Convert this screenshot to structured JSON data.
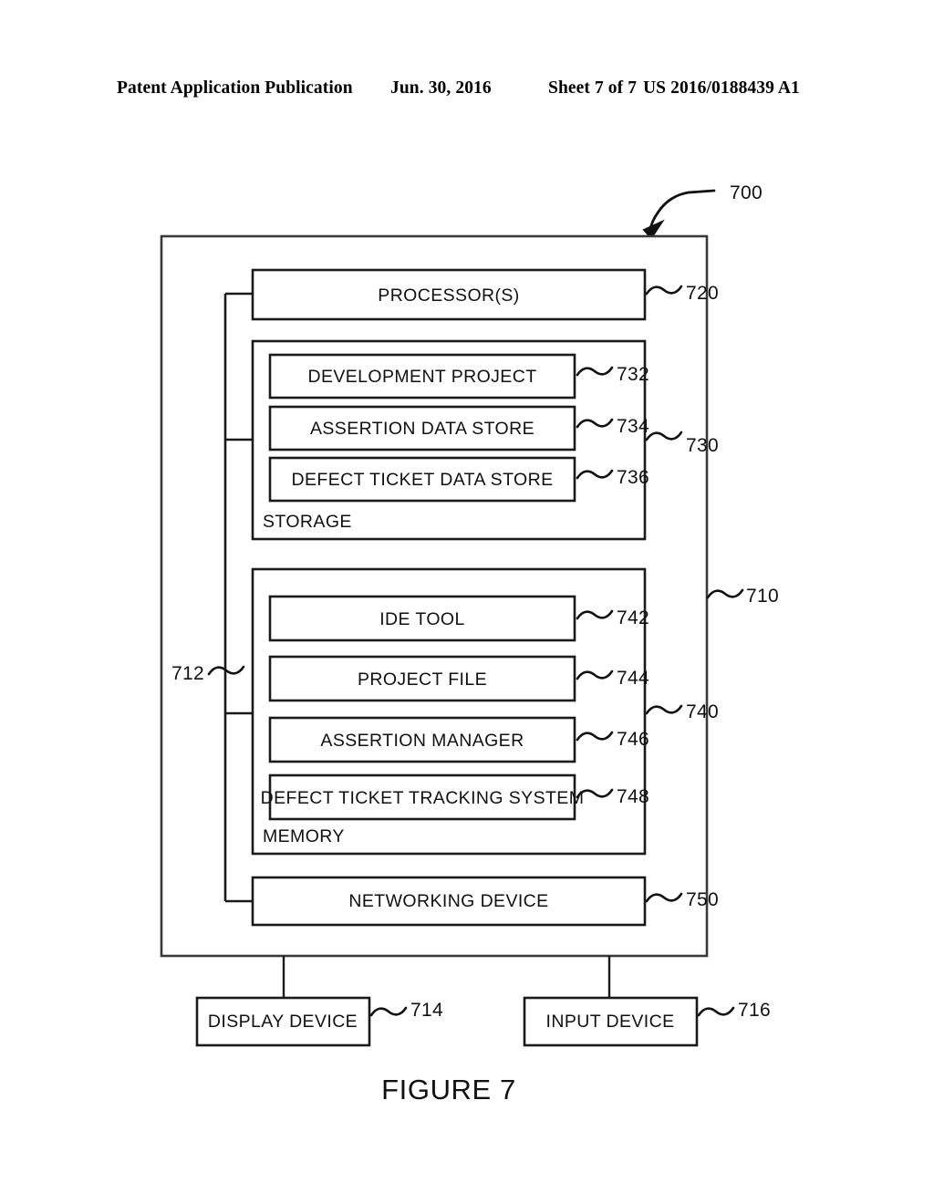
{
  "header": {
    "publication": "Patent Application Publication",
    "date": "Jun. 30, 2016",
    "sheet": "Sheet 7 of 7",
    "patent_number": "US 2016/0188439 A1"
  },
  "figure": {
    "caption": "FIGURE 7",
    "system_ref": "700",
    "computing_device_ref": "710",
    "bus_ref": "712",
    "blocks": {
      "processor": {
        "label": "PROCESSOR(S)",
        "ref": "720"
      },
      "storage": {
        "label": "STORAGE",
        "ref": "730"
      },
      "development_project": {
        "label": "DEVELOPMENT PROJECT",
        "ref": "732"
      },
      "assertion_data_store": {
        "label": "ASSERTION DATA STORE",
        "ref": "734"
      },
      "defect_ticket_data_store": {
        "label": "DEFECT TICKET DATA STORE",
        "ref": "736"
      },
      "memory": {
        "label": "MEMORY",
        "ref": "740"
      },
      "ide_tool": {
        "label": "IDE TOOL",
        "ref": "742"
      },
      "project_file": {
        "label": "PROJECT FILE",
        "ref": "744"
      },
      "assertion_manager": {
        "label": "ASSERTION MANAGER",
        "ref": "746"
      },
      "defect_ticket_tracking_system": {
        "label": "DEFECT TICKET TRACKING SYSTEM",
        "ref": "748"
      },
      "networking_device": {
        "label": "NETWORKING DEVICE",
        "ref": "750"
      },
      "display_device": {
        "label": "DISPLAY DEVICE",
        "ref": "714"
      },
      "input_device": {
        "label": "INPUT DEVICE",
        "ref": "716"
      }
    }
  },
  "colors": {
    "ink": "#111111",
    "outline": "#1a1a1a",
    "paper": "#ffffff"
  }
}
